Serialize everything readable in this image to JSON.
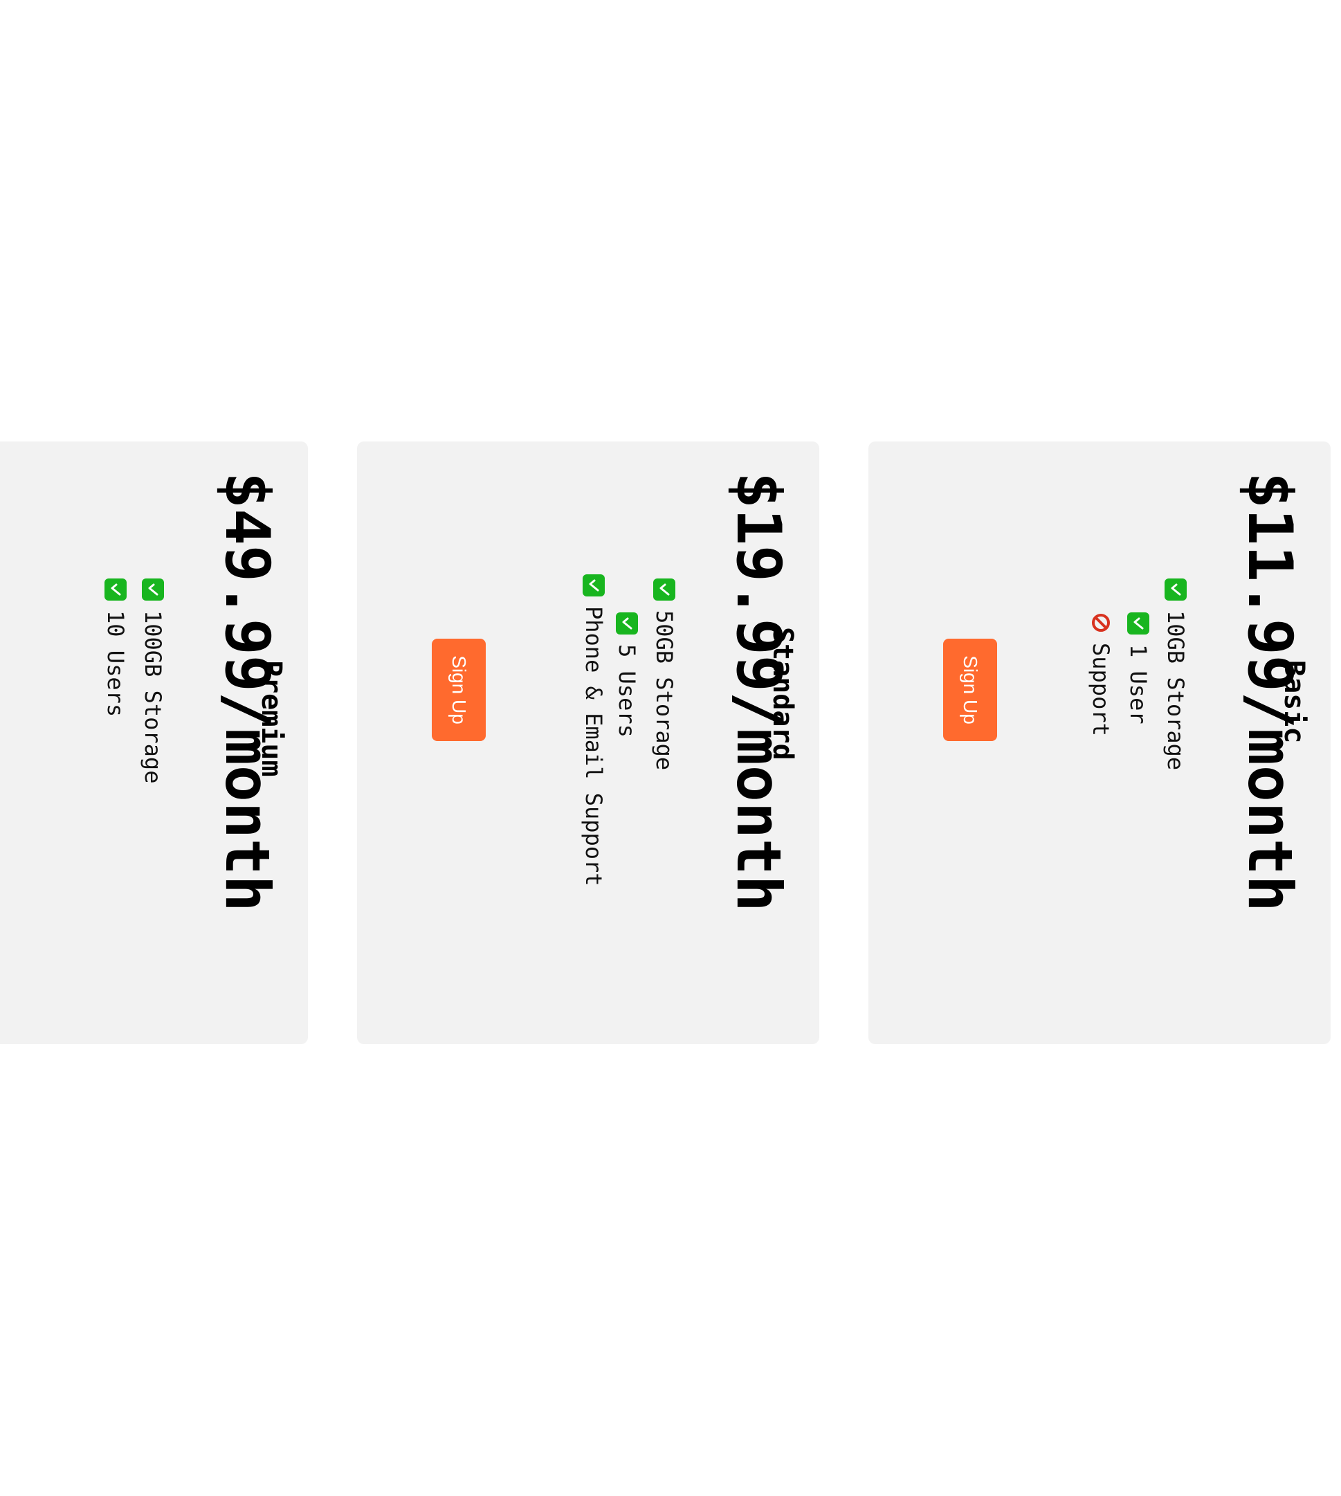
{
  "plans": [
    {
      "name": "Basic",
      "price": "$11.99/month",
      "features": [
        {
          "label": "10GB Storage",
          "included": true
        },
        {
          "label": "1 User",
          "included": true
        },
        {
          "label": "Support",
          "included": false
        }
      ],
      "cta": "Sign Up"
    },
    {
      "name": "Standard",
      "price": "$19.99/month",
      "features": [
        {
          "label": "50GB Storage",
          "included": true
        },
        {
          "label": "5 Users",
          "included": true
        },
        {
          "label": "Phone & Email Support",
          "included": true
        }
      ],
      "cta": "Sign Up"
    },
    {
      "name": "Premium",
      "price": "$49.99/month",
      "features": [
        {
          "label": "100GB Storage",
          "included": true
        },
        {
          "label": "10 Users",
          "included": true
        }
      ]
    }
  ],
  "colors": {
    "card_bg": "#f2f2f2",
    "accent": "#ff6a2e",
    "check": "#18b51f",
    "blocked": "#d8321f"
  },
  "icons": {
    "included": "check-icon",
    "excluded": "no-entry-icon"
  }
}
